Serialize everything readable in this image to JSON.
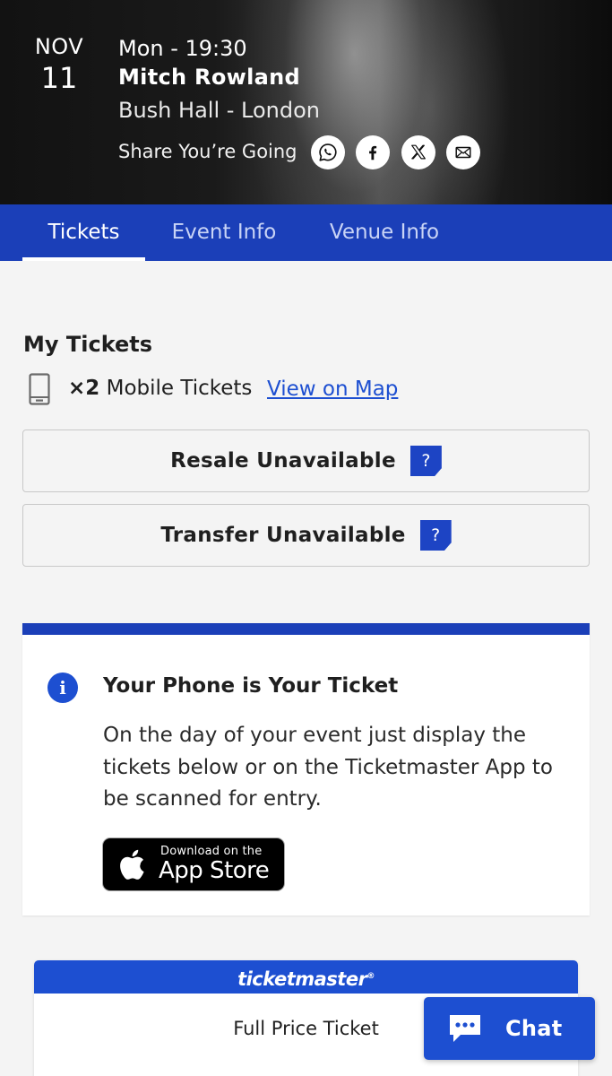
{
  "event": {
    "month": "NOV",
    "day": "11",
    "time": "Mon - 19:30",
    "artist": "Mitch Rowland",
    "venue": "Bush Hall - London",
    "share_label": "Share You’re Going",
    "share_buttons": [
      {
        "icon": "whatsapp-icon"
      },
      {
        "icon": "facebook-icon"
      },
      {
        "icon": "x-icon"
      },
      {
        "icon": "email-icon"
      }
    ]
  },
  "tabs": [
    {
      "label": "Tickets",
      "active": true
    },
    {
      "label": "Event Info",
      "active": false
    },
    {
      "label": "Venue Info",
      "active": false
    }
  ],
  "my_tickets": {
    "title": "My Tickets",
    "count": "×2",
    "type": "Mobile Tickets",
    "map_link": "View on Map",
    "resale_label": "Resale Unavailable",
    "transfer_label": "Transfer Unavailable",
    "help_glyph": "?"
  },
  "info_card": {
    "icon_glyph": "i",
    "title": "Your Phone is Your Ticket",
    "body": "On the day of your event just display the tickets below or on the Ticketmaster App to be scanned for entry.",
    "appstore_small": "Download on the",
    "appstore_big": "App Store"
  },
  "ticket": {
    "brand": "ticketmaster",
    "brand_mark": "®",
    "type": "Full Price Ticket"
  },
  "chat": {
    "label": "Chat"
  },
  "colors": {
    "brand_blue": "#1b3fb8",
    "link_blue": "#1d4fd1",
    "background": "#f4f4f4"
  }
}
